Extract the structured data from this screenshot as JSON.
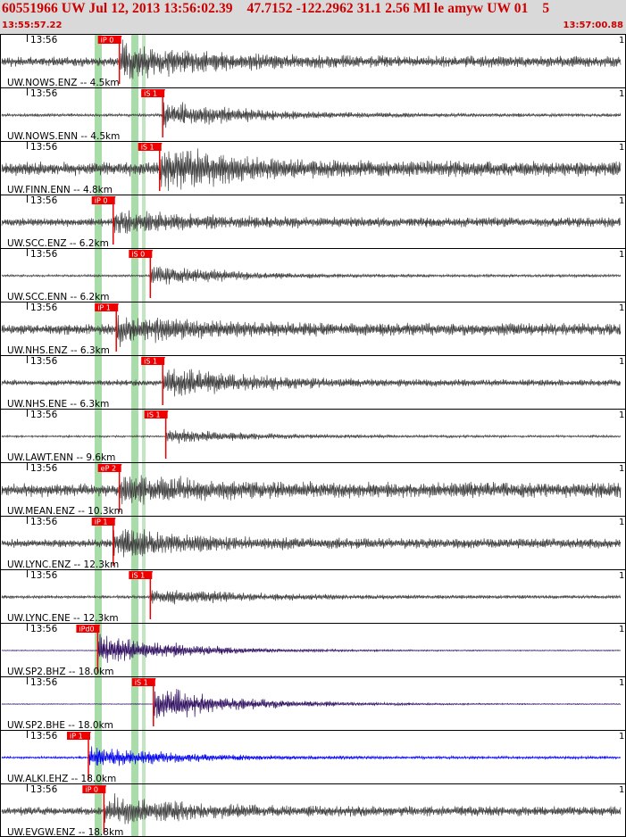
{
  "header": {
    "title": "60551966 UW Jul 12, 2013 13:56:02.39    47.7152 -122.2962 31.1 2.56 Ml le amyw UW 01    5",
    "start_time": "13:55:57.22",
    "end_time": "13:57:00.88"
  },
  "colors": {
    "header_bg": "#d9d9d9",
    "header_text": "#cc0000",
    "trace_default": "#404040",
    "trace_broadband": "#301060",
    "trace_alki": "#0000ee",
    "pick_flag": "#ee0000",
    "predicted_p_band": "#a8dca8",
    "predicted_s_band": "#a8dca8"
  },
  "panels": [
    {
      "time_label": "13:56",
      "station": "UW.NOWS.ENZ",
      "label": "UW.NOWS.ENZ -- 4.5km",
      "scale": "1",
      "pick": "iP 0",
      "pick_type": "P",
      "pick_t": 0.19,
      "amplitude": 0.85,
      "noise": 0.25,
      "color": "trace_default"
    },
    {
      "time_label": "13:56",
      "station": "UW.NOWS.ENN",
      "label": "UW.NOWS.ENN -- 4.5km",
      "scale": "1",
      "pick": "iS 1",
      "pick_type": "S",
      "pick_t": 0.26,
      "amplitude": 0.7,
      "noise": 0.08,
      "color": "trace_default"
    },
    {
      "time_label": "13:56",
      "station": "UW.FINN.ENN",
      "label": "UW.FINN.ENN -- 4.8km",
      "scale": "1",
      "pick": "iS 1",
      "pick_type": "S",
      "pick_t": 0.255,
      "amplitude": 0.95,
      "noise": 0.35,
      "color": "trace_default"
    },
    {
      "time_label": "13:56",
      "station": "UW.SCC.ENZ",
      "label": "UW.SCC.ENZ -- 6.2km",
      "scale": "1",
      "pick": "iP 0",
      "pick_type": "P",
      "pick_t": 0.18,
      "amplitude": 0.5,
      "noise": 0.22,
      "color": "trace_default"
    },
    {
      "time_label": "13:56",
      "station": "UW.SCC.ENN",
      "label": "UW.SCC.ENN -- 6.2km",
      "scale": "1",
      "pick": "iS 0",
      "pick_type": "S",
      "pick_t": 0.24,
      "amplitude": 0.55,
      "noise": 0.06,
      "color": "trace_default"
    },
    {
      "time_label": "13:56",
      "station": "UW.NHS.ENZ",
      "label": "UW.NHS.ENZ -- 6.3km",
      "scale": "1",
      "pick": "iP 1",
      "pick_type": "P",
      "pick_t": 0.185,
      "amplitude": 0.6,
      "noise": 0.28,
      "color": "trace_default"
    },
    {
      "time_label": "13:56",
      "station": "UW.NHS.ENE",
      "label": "UW.NHS.ENE -- 6.3km",
      "scale": "1",
      "pick": "iS 1",
      "pick_type": "S",
      "pick_t": 0.26,
      "amplitude": 0.75,
      "noise": 0.15,
      "color": "trace_default"
    },
    {
      "time_label": "13:56",
      "station": "UW.LAWT.ENN",
      "label": "UW.LAWT.ENN -- 9.6km",
      "scale": "1",
      "pick": "iS 1",
      "pick_type": "S",
      "pick_t": 0.265,
      "amplitude": 0.4,
      "noise": 0.05,
      "color": "trace_default"
    },
    {
      "time_label": "13:56",
      "station": "UW.MEAN.ENZ",
      "label": "UW.MEAN.ENZ -- 10.3km",
      "scale": "1",
      "pick": "eP 2",
      "pick_type": "P",
      "pick_t": 0.19,
      "amplitude": 0.55,
      "noise": 0.35,
      "color": "trace_default"
    },
    {
      "time_label": "13:56",
      "station": "UW.LYNC.ENZ",
      "label": "UW.LYNC.ENZ -- 12.3km",
      "scale": "1",
      "pick": "iP 1",
      "pick_type": "P",
      "pick_t": 0.18,
      "amplitude": 0.7,
      "noise": 0.22,
      "color": "trace_default"
    },
    {
      "time_label": "13:56",
      "station": "UW.LYNC.ENE",
      "label": "UW.LYNC.ENE -- 12.3km",
      "scale": "1",
      "pick": "iS 1",
      "pick_type": "S",
      "pick_t": 0.24,
      "amplitude": 0.5,
      "noise": 0.08,
      "color": "trace_default"
    },
    {
      "time_label": "13:56",
      "station": "UW.SP2.BHZ",
      "label": "UW.SP2.BHZ -- 18.0km",
      "scale": "1",
      "pick": "iPd0",
      "pick_type": "P",
      "pick_t": 0.155,
      "amplitude": 0.9,
      "noise": 0.02,
      "color": "trace_broadband"
    },
    {
      "time_label": "13:56",
      "station": "UW.SP2.BHE",
      "label": "UW.SP2.BHE -- 18.0km",
      "scale": "1",
      "pick": "iS 1",
      "pick_type": "S",
      "pick_t": 0.245,
      "amplitude": 0.95,
      "noise": 0.02,
      "color": "trace_broadband"
    },
    {
      "time_label": "13:56",
      "station": "UW.ALKI.EHZ",
      "label": "UW.ALKI.EHZ -- 18.0km",
      "scale": "1",
      "pick": "iP 1",
      "pick_type": "P",
      "pick_t": 0.14,
      "amplitude": 0.55,
      "noise": 0.06,
      "color": "trace_alki"
    },
    {
      "time_label": "13:56",
      "station": "UW.EVGW.ENZ",
      "label": "UW.EVGW.ENZ -- 18.8km",
      "scale": "1",
      "pick": "iP 0",
      "pick_type": "P",
      "pick_t": 0.165,
      "amplitude": 0.7,
      "noise": 0.22,
      "color": "trace_default"
    }
  ]
}
